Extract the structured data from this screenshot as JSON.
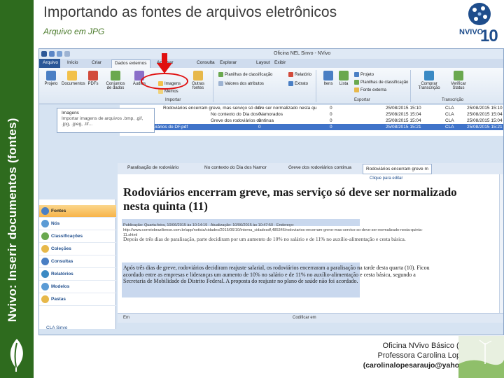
{
  "slide": {
    "title": "Importando as fontes de arquivos eletrônicos",
    "subtitle": "Arquivo em JPG",
    "side_label": "Nvivo: Inserir documentos (fontes)",
    "logo_word": "NVIVO",
    "logo_version": "10"
  },
  "app": {
    "window_title": "Oficina NEL Sinvo - NVivo",
    "tabs": [
      "Arquivo",
      "Início",
      "Criar",
      "Dados externos",
      "Analisar",
      "Consulta",
      "Explorar",
      "Layout",
      "Exibir"
    ],
    "active_tab": "Dados externos"
  },
  "ribbon": {
    "big_buttons": [
      "Projeto",
      "Documentos",
      "PDFs",
      "Conjuntos de dados",
      "Áudios"
    ],
    "small_items": [
      "Imagens",
      "Memos",
      "Outras fontes"
    ],
    "classif_items": [
      "Planilhas de classificação",
      "Valores dos atributos"
    ],
    "report_items": [
      "Relatório",
      "Extrato"
    ],
    "export_items": [
      "Itens",
      "Lista",
      "Projeto",
      "Planilhas de classificação",
      "Fonte externa"
    ],
    "transcribe_items": [
      "Comprar Transcrição",
      "Verificar Status"
    ],
    "group_importar": "Importar",
    "group_exportar": "Exportar",
    "group_transcricao": "Transcrição"
  },
  "tooltip": {
    "title": "Imagens",
    "desc": "Importar imagens de arquivos .bmp, .gif, .jpg, .jpeg, .tif..."
  },
  "grid": {
    "rows": [
      {
        "name": "Rodoviários encerram greve, mas serviço só deve ser normalizado nesta qu",
        "a": "0",
        "b": "0",
        "created": "25/08/2015 15:10",
        "by": "CLA",
        "modified": "25/08/2015 15:10"
      },
      {
        "name": "No contexto do Dia dos Namorados",
        "a": "0",
        "b": "0",
        "created": "25/08/2015 15:04",
        "by": "CLA",
        "modified": "25/08/2015 15:04"
      },
      {
        "name": "Greve dos rodoviários continua",
        "a": "0",
        "b": "0",
        "created": "25/08/2015 15:04",
        "by": "CLA",
        "modified": "25/08/2015 15:04"
      },
      {
        "name": "Greve dos rodoviários do DF.pdf",
        "a": "0",
        "b": "0",
        "created": "25/08/2015 15:21",
        "by": "CLA",
        "modified": "25/08/2015 15:21"
      }
    ]
  },
  "nav": {
    "items": [
      "Fontes",
      "Nós",
      "Classificações",
      "Coleções",
      "Consultas",
      "Relatórios",
      "Modelos",
      "Pastas"
    ],
    "active": "Fontes",
    "bottom": "CLA Sinvo"
  },
  "doc": {
    "tabs": [
      "Paralisação de rodoviário",
      "No contexto do Dia dos Namor",
      "Greve dos rodoviários continua",
      "Rodoviários encerram greve m"
    ],
    "sub": "Clique para editar",
    "headline": "Rodoviários encerram greve, mas serviço só deve ser normalizado nesta quinta (11)",
    "meta": "Publicação: Quarta-feira, 10/06/2015 às 10:14:19 · Atualização: 10/06/2015 às 10:47:50 · Endereço: http://www.correiobraziliense.com.br/app/noticia/cidades/2015/06/10/interna_cidadesdf,485346/rodoviarios-encerram-greve-mas-servico-so-deve-ser-normalizado-nesta-quinta-11.shtml",
    "para1": "Depois de três dias de paralisação, parte decidiram por um aumento de 10% no salário e de 11% no auxílio-alimentação e cesta básica.",
    "para2": "Após três dias de greve, rodoviários decidiram reajuste salarial, os rodoviários encerraram a paralisação na tarde desta quarta (10). Ficou acordado entre as empresas e lideranças um aumento de 10% no salário e de 11% no auxílio-alimentação e cesta básica, segundo a Secretaria de Mobilidade do Distrito Federal. A proposta do reajuste no plano de saúde não foi acordado."
  },
  "statusbar": {
    "left": "Em",
    "right": "Codificar em"
  },
  "credits": {
    "line1": "Oficina NVivo Básico (extensão)",
    "line2": "Professora Carolina Lopes Araujo",
    "email": "(carolinalopesaraujo@yahoo.com.br)"
  },
  "colors": {
    "band": "#2e6b1e",
    "accent_red": "#e01010",
    "selection": "#3f73c9",
    "brand_blue": "#1e4d8c"
  }
}
